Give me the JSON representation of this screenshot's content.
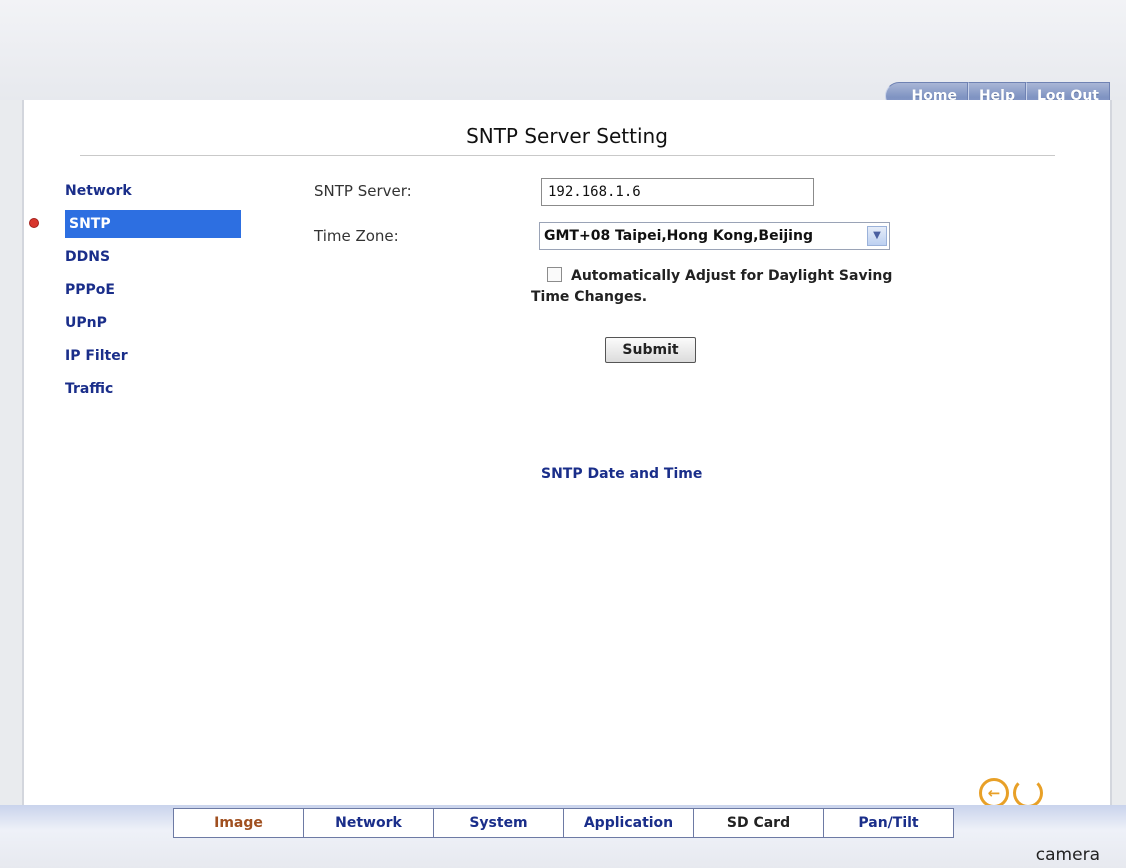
{
  "header": {
    "nav": [
      "Home",
      "Help",
      "Log Out"
    ]
  },
  "page": {
    "title": "SNTP Server Setting"
  },
  "sidebar": {
    "items": [
      {
        "label": "Network"
      },
      {
        "label": "SNTP",
        "active": true
      },
      {
        "label": "DDNS"
      },
      {
        "label": "PPPoE"
      },
      {
        "label": "UPnP"
      },
      {
        "label": "IP Filter"
      },
      {
        "label": "Traffic"
      }
    ]
  },
  "form": {
    "sntp_server_label": "SNTP Server:",
    "sntp_server_value": "192.168.1.6",
    "time_zone_label": "Time Zone:",
    "time_zone_value": "GMT+08 Taipei,Hong Kong,Beijing",
    "daylight_label": "Automatically Adjust for Daylight Saving",
    "daylight_label_cont": "Time Changes.",
    "daylight_checked": false,
    "submit_label": "Submit"
  },
  "sntp_date_time_label": "SNTP Date and Time",
  "icons": {
    "back": "arrow-left-icon",
    "refresh": "refresh-icon"
  },
  "bottom_tabs": [
    "Image",
    "Network",
    "System",
    "Application",
    "SD Card",
    "Pan/Tilt"
  ],
  "footer": {
    "brand": "camera"
  },
  "colors": {
    "link": "#1a2e8a",
    "active_bg": "#2d6fe1",
    "accent": "#e8a027"
  }
}
